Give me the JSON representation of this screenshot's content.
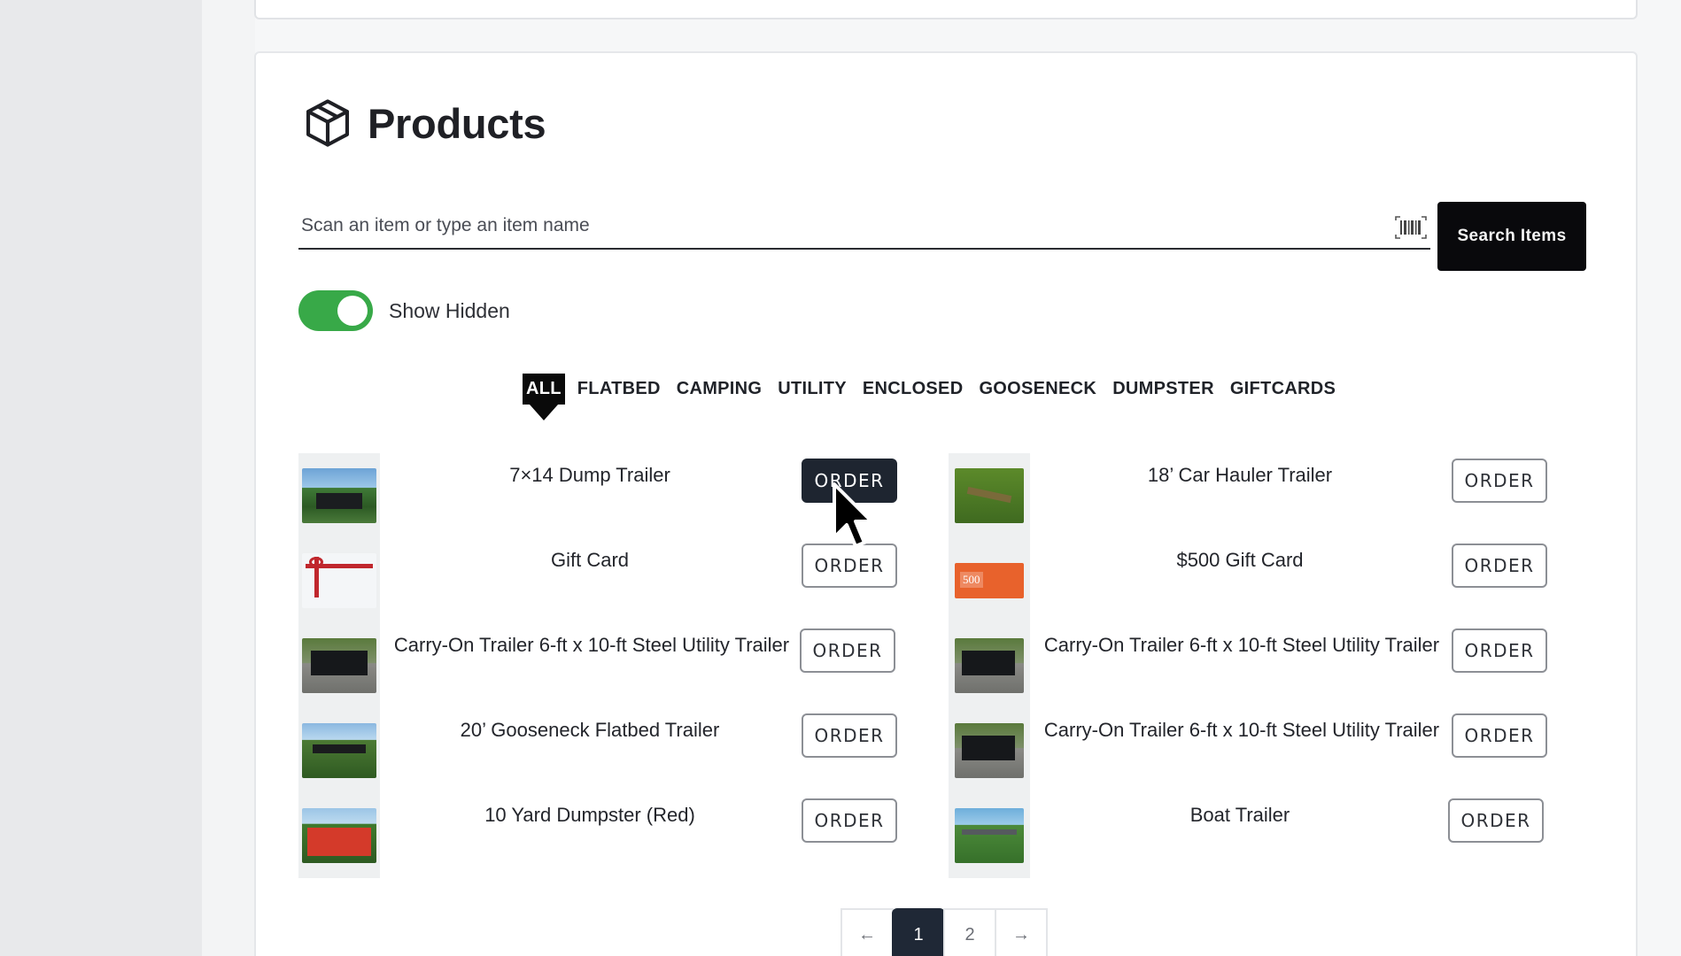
{
  "page": {
    "title": "Products"
  },
  "search": {
    "placeholder": "Scan an item or type an item name",
    "button_label": "Search Items",
    "barcode_icon": "barcode-icon"
  },
  "toggle": {
    "label": "Show Hidden",
    "on": true,
    "color": "#38a948"
  },
  "filters": [
    {
      "label": "ALL",
      "active": true
    },
    {
      "label": "FLATBED",
      "active": false
    },
    {
      "label": "CAMPING",
      "active": false
    },
    {
      "label": "UTILITY",
      "active": false
    },
    {
      "label": "ENCLOSED",
      "active": false
    },
    {
      "label": "GOOSENECK",
      "active": false
    },
    {
      "label": "DUMPSTER",
      "active": false
    },
    {
      "label": "GIFTCARDS",
      "active": false
    }
  ],
  "products_left": [
    {
      "name": "7×14 Dump Trailer",
      "order_label": "ORDER",
      "highlighted": true,
      "thumb_color": "#2c6b34"
    },
    {
      "name": "Gift Card",
      "order_label": "ORDER",
      "highlighted": false,
      "thumb_color": "#f4f6f8"
    },
    {
      "name": "Carry-On Trailer 6-ft x 10-ft Steel Utility Trailer",
      "order_label": "ORDER",
      "highlighted": false,
      "thumb_color": "#3d4a35"
    },
    {
      "name": "20’ Gooseneck Flatbed Trailer",
      "order_label": "ORDER",
      "highlighted": false,
      "thumb_color": "#3a5a2c"
    },
    {
      "name": "10 Yard Dumpster (Red)",
      "order_label": "ORDER",
      "highlighted": false,
      "thumb_color": "#d43a2a"
    }
  ],
  "products_right": [
    {
      "name": "18’ Car Hauler Trailer",
      "order_label": "ORDER",
      "highlighted": false,
      "thumb_color": "#4f7a2a"
    },
    {
      "name": "$500 Gift Card",
      "order_label": "ORDER",
      "highlighted": false,
      "thumb_color": "#e8622c"
    },
    {
      "name": "Carry-On Trailer 6-ft x 10-ft Steel Utility Trailer",
      "order_label": "ORDER",
      "highlighted": false,
      "thumb_color": "#3d4a35"
    },
    {
      "name": "Carry-On Trailer 6-ft x 10-ft Steel Utility Trailer",
      "order_label": "ORDER",
      "highlighted": false,
      "thumb_color": "#3d4a35"
    },
    {
      "name": "Boat Trailer",
      "order_label": "ORDER",
      "highlighted": false,
      "thumb_color": "#3f7f3a"
    }
  ],
  "pagination": {
    "prev": "←",
    "pages": [
      "1",
      "2"
    ],
    "current": "1",
    "next": "→"
  },
  "gift_card_thumb_text": "500"
}
